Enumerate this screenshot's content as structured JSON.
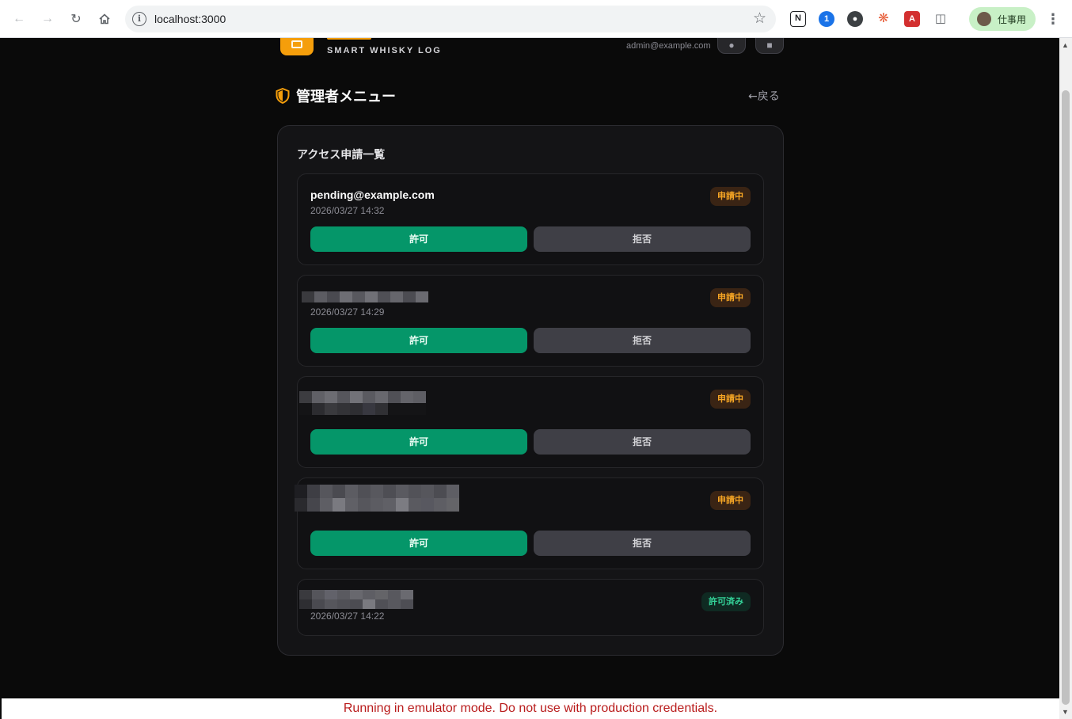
{
  "browser": {
    "url": "localhost:3000",
    "profile_label": "仕事用"
  },
  "app": {
    "tagline": "SMART WHISKY LOG",
    "user_email": "admin@example.com"
  },
  "admin": {
    "title": "管理者メニュー",
    "back_label": "戻る"
  },
  "requests": {
    "title": "アクセス申請一覧",
    "approve_label": "許可",
    "reject_label": "拒否",
    "items": [
      {
        "email": "pending@example.com",
        "date": "2026/03/27 14:32",
        "status": "申請中"
      },
      {
        "email": "",
        "date": "2026/03/27 14:29",
        "status": "申請中"
      },
      {
        "email": "",
        "date": "",
        "status": "申請中"
      },
      {
        "email": "",
        "date": "",
        "status": "申請中"
      },
      {
        "email": "",
        "date": "2026/03/27 14:22",
        "status": "許可済み"
      }
    ]
  },
  "banner": {
    "text": "Running in emulator mode. Do not use with production credentials."
  },
  "colors": {
    "accent": "#f59e0b",
    "approve": "#059669",
    "reject": "#3f3f46",
    "pending": "#f5a524",
    "approved": "#34d399",
    "warning": "#b91c1c"
  }
}
